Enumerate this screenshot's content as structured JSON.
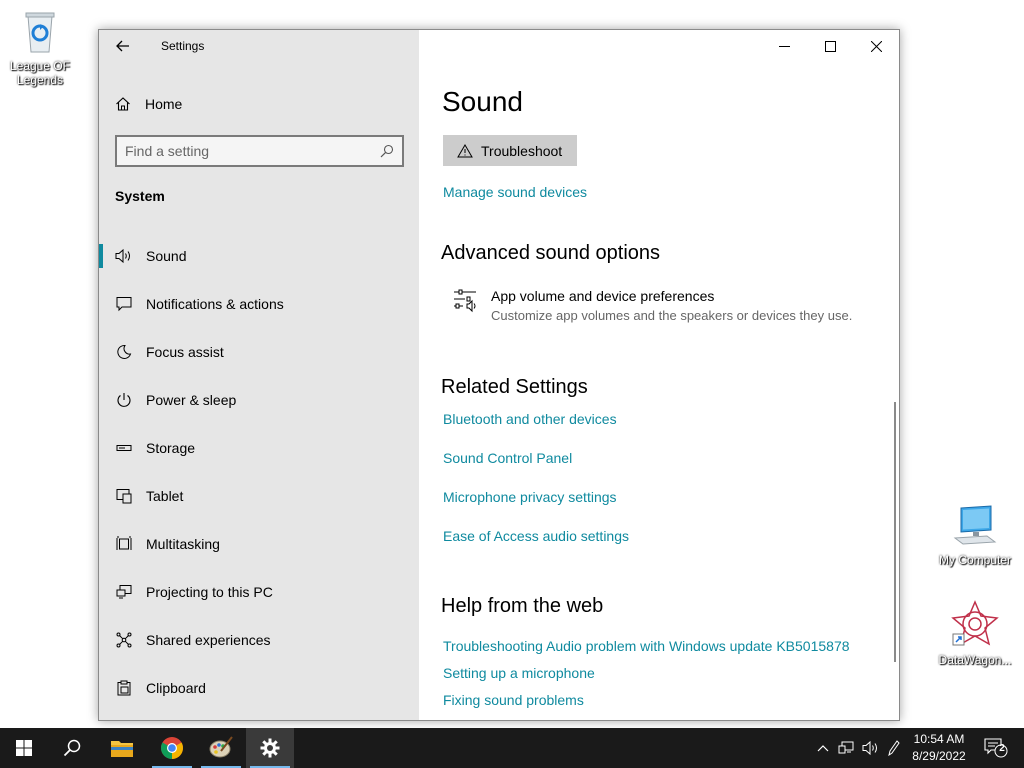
{
  "desktop": {
    "icons": [
      {
        "label": "League OF Legends"
      },
      {
        "label": "My Computer"
      },
      {
        "label": "DataWagon..."
      }
    ]
  },
  "window": {
    "app_title": "Settings",
    "controls": [
      "minimize",
      "maximize",
      "close"
    ]
  },
  "sidebar": {
    "home_label": "Home",
    "search_placeholder": "Find a setting",
    "section_title": "System",
    "items": [
      {
        "label": "Sound",
        "icon": "speaker-icon",
        "active": true
      },
      {
        "label": "Notifications & actions",
        "icon": "notification-icon"
      },
      {
        "label": "Focus assist",
        "icon": "moon-icon"
      },
      {
        "label": "Power & sleep",
        "icon": "power-icon"
      },
      {
        "label": "Storage",
        "icon": "storage-icon"
      },
      {
        "label": "Tablet",
        "icon": "tablet-icon"
      },
      {
        "label": "Multitasking",
        "icon": "multitasking-icon"
      },
      {
        "label": "Projecting to this PC",
        "icon": "projecting-icon"
      },
      {
        "label": "Shared experiences",
        "icon": "shared-icon"
      },
      {
        "label": "Clipboard",
        "icon": "clipboard-icon"
      }
    ]
  },
  "main": {
    "title": "Sound",
    "troubleshoot_label": "Troubleshoot",
    "manage_link": "Manage sound devices",
    "advanced": {
      "heading": "Advanced sound options",
      "option_title": "App volume and device preferences",
      "option_desc": "Customize app volumes and the speakers or devices they use."
    },
    "related": {
      "heading": "Related Settings",
      "links": [
        "Bluetooth and other devices",
        "Sound Control Panel",
        "Microphone privacy settings",
        "Ease of Access audio settings"
      ]
    },
    "help": {
      "heading": "Help from the web",
      "links": [
        "Troubleshooting Audio problem with Windows update KB5015878",
        "Setting up a microphone",
        "Fixing sound problems"
      ]
    }
  },
  "taskbar": {
    "time": "10:54 AM",
    "date": "8/29/2022",
    "notification_count": "2"
  },
  "colors": {
    "accent": "#0f8a9f",
    "sidebar_bg": "#e6e6e6",
    "taskbar_bg": "#1a1a1a"
  }
}
